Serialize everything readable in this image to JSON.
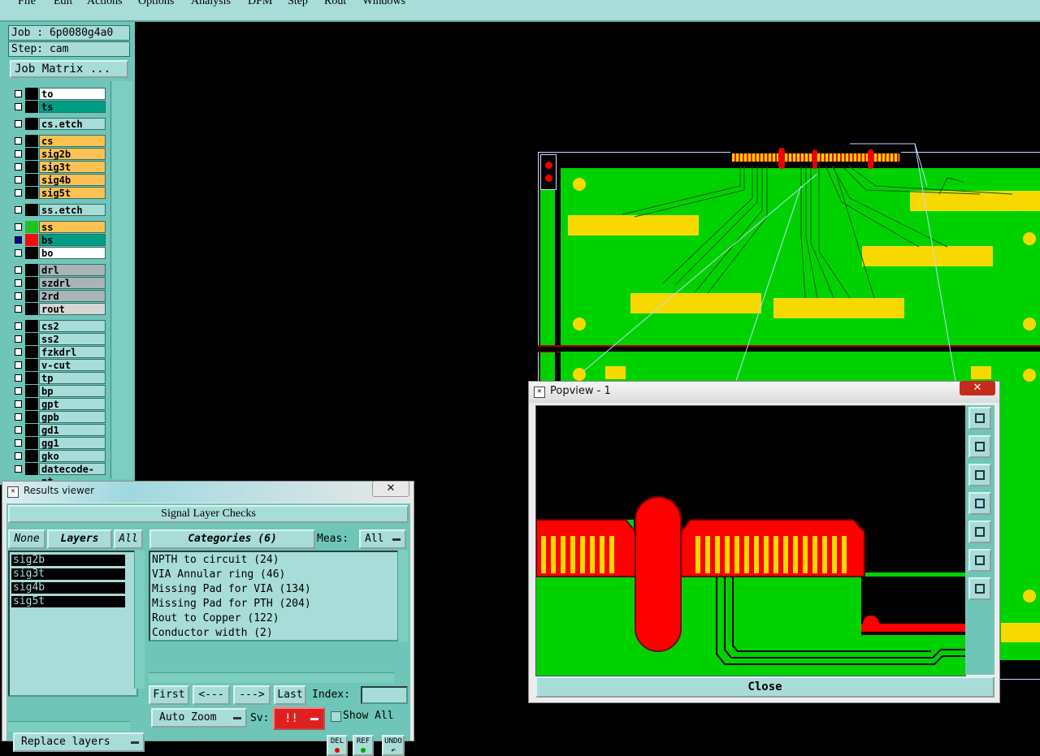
{
  "menubar": {
    "items": [
      "File",
      "Edit",
      "Actions",
      "Options",
      "Analysis",
      "DFM",
      "Step",
      "Rout",
      "Windows"
    ]
  },
  "job": {
    "job_label": "Job : 6p0080g4a0",
    "step_label": "Step: cam",
    "matrix_button": "Job Matrix ..."
  },
  "layers": [
    {
      "name": "to",
      "color": "#ffffff",
      "swatch": "#000000",
      "group": 1
    },
    {
      "name": "ts",
      "color": "#009e85",
      "swatch": "#000000",
      "group": 1
    },
    {
      "name": "cs.etch",
      "color": "#a8dcd8",
      "swatch": "#000000",
      "group": 2
    },
    {
      "name": "cs",
      "color": "#ffc252",
      "swatch": "#000000",
      "group": 3
    },
    {
      "name": "sig2b",
      "color": "#ffc252",
      "swatch": "#000000",
      "group": 3
    },
    {
      "name": "sig3t",
      "color": "#ffc252",
      "swatch": "#000000",
      "group": 3
    },
    {
      "name": "sig4b",
      "color": "#ffc252",
      "swatch": "#000000",
      "group": 3
    },
    {
      "name": "sig5t",
      "color": "#ffc252",
      "swatch": "#000000",
      "group": 3
    },
    {
      "name": "ss.etch",
      "color": "#a8dcd8",
      "swatch": "#000000",
      "group": 4
    },
    {
      "name": "ss",
      "color": "#ffc252",
      "swatch": "#22c022",
      "group": 5
    },
    {
      "name": "bs",
      "color": "#009e85",
      "swatch": "#ee1010",
      "group": 5,
      "checked": true
    },
    {
      "name": "bo",
      "color": "#ffffff",
      "swatch": "#000000",
      "group": 5
    },
    {
      "name": "drl",
      "color": "#a8b4b8",
      "swatch": "#000000",
      "group": 6
    },
    {
      "name": "szdrl",
      "color": "#a8b4b8",
      "swatch": "#000000",
      "group": 6
    },
    {
      "name": "2rd",
      "color": "#a8b4b8",
      "swatch": "#000000",
      "group": 6
    },
    {
      "name": "rout",
      "color": "#d6d6d6",
      "swatch": "#000000",
      "group": 6
    },
    {
      "name": "cs2",
      "color": "#a8dcd8",
      "swatch": "#000000",
      "group": 7
    },
    {
      "name": "ss2",
      "color": "#a8dcd8",
      "swatch": "#000000",
      "group": 7
    },
    {
      "name": "fzkdrl",
      "color": "#a8dcd8",
      "swatch": "#000000",
      "group": 7
    },
    {
      "name": "v-cut",
      "color": "#a8dcd8",
      "swatch": "#000000",
      "group": 7
    },
    {
      "name": "tp",
      "color": "#a8dcd8",
      "swatch": "#000000",
      "group": 7
    },
    {
      "name": "bp",
      "color": "#a8dcd8",
      "swatch": "#000000",
      "group": 7
    },
    {
      "name": "gpt",
      "color": "#a8dcd8",
      "swatch": "#000000",
      "group": 7
    },
    {
      "name": "gpb",
      "color": "#a8dcd8",
      "swatch": "#000000",
      "group": 7
    },
    {
      "name": "gd1",
      "color": "#a8dcd8",
      "swatch": "#000000",
      "group": 7
    },
    {
      "name": "gg1",
      "color": "#a8dcd8",
      "swatch": "#000000",
      "group": 7
    },
    {
      "name": "gko",
      "color": "#a8dcd8",
      "swatch": "#000000",
      "group": 7
    },
    {
      "name": "datecode-pt",
      "color": "#a8dcd8",
      "swatch": "#000000",
      "group": 7
    }
  ],
  "popview": {
    "title": "Popview - 1",
    "close_label": "Close",
    "close_x": "✕"
  },
  "results": {
    "title": "Results viewer",
    "close_x": "✕",
    "header": "Signal Layer Checks",
    "none_label": "None",
    "layers_label": "Layers",
    "all_label": "All",
    "categories_label": "Categories (6)",
    "meas_label": "Meas:",
    "meas_value": "All",
    "layer_list": [
      "sig2b",
      "sig3t",
      "sig4b",
      "sig5t"
    ],
    "categories": [
      "NPTH to circuit (24)",
      "VIA Annular ring (46)",
      "Missing Pad for VIA (134)",
      "Missing Pad for PTH (204)",
      "Rout to Copper (122)",
      "Conductor width (2)"
    ],
    "first_label": "First",
    "prev_label": "<---",
    "next_label": "--->",
    "last_label": "Last",
    "index_label": "Index:",
    "index_value": "",
    "zoom_label": "Auto Zoom",
    "sv_label": "Sv:",
    "sv_value": "!!",
    "show_all_label": "Show All",
    "replace_label": "Replace layers",
    "del_label": "DEL",
    "ref_label": "REF",
    "undo_label": "UNDO"
  }
}
